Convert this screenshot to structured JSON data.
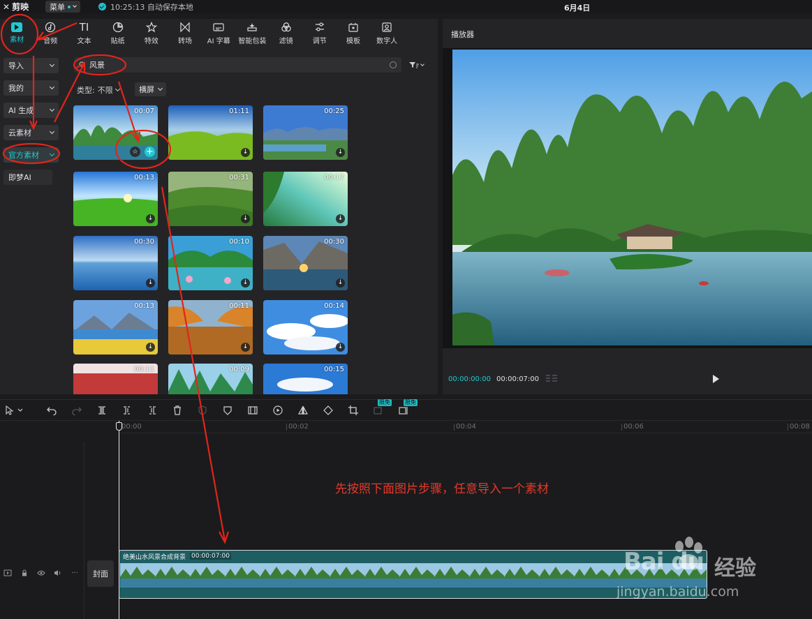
{
  "titlebar": {
    "app_name": "剪映",
    "menu_label": "菜单",
    "save_status": "10:25:13 自动保存本地",
    "date": "6月4日"
  },
  "toolbar": {
    "items": [
      {
        "label": "素材",
        "icon": "media-icon",
        "active": true
      },
      {
        "label": "音频",
        "icon": "audio-icon"
      },
      {
        "label": "文本",
        "icon": "text-icon"
      },
      {
        "label": "贴纸",
        "icon": "sticker-icon"
      },
      {
        "label": "特效",
        "icon": "effects-icon"
      },
      {
        "label": "转场",
        "icon": "transition-icon"
      },
      {
        "label": "AI 字幕",
        "icon": "subtitle-icon"
      },
      {
        "label": "智能包装",
        "icon": "smart-pack-icon"
      },
      {
        "label": "滤镜",
        "icon": "filter-icon"
      },
      {
        "label": "调节",
        "icon": "adjust-icon"
      },
      {
        "label": "模板",
        "icon": "template-icon"
      },
      {
        "label": "数字人",
        "icon": "digital-human-icon"
      }
    ]
  },
  "sidebar": {
    "items": [
      {
        "label": "导入"
      },
      {
        "label": "我的"
      },
      {
        "label": "AI 生成"
      },
      {
        "label": "云素材"
      },
      {
        "label": "官方素材",
        "active": true
      },
      {
        "label": "即梦AI"
      }
    ]
  },
  "search": {
    "value": "风景"
  },
  "filters": {
    "type_label": "类型:",
    "type_value": "不限",
    "orientation": "横屏"
  },
  "thumbnails": [
    {
      "duration": "00:07"
    },
    {
      "duration": "01:11"
    },
    {
      "duration": "00:25"
    },
    {
      "duration": "00:13"
    },
    {
      "duration": "00:31"
    },
    {
      "duration": "00:17"
    },
    {
      "duration": "00:30"
    },
    {
      "duration": "00:10"
    },
    {
      "duration": "00:30"
    },
    {
      "duration": "00:13"
    },
    {
      "duration": "00:11"
    },
    {
      "duration": "00:14"
    },
    {
      "duration": "00:11"
    },
    {
      "duration": "00:09"
    },
    {
      "duration": "00:15"
    }
  ],
  "player": {
    "title": "播放器",
    "current_time": "00:00:00:00",
    "total_time": "00:00:07:00"
  },
  "timeline_toolbar": {
    "badge_1": "限免",
    "badge_2": "限免"
  },
  "ruler": [
    "00:00",
    "00:02",
    "00:04",
    "00:06",
    "00:08"
  ],
  "track": {
    "cover_label": "封面"
  },
  "clip": {
    "title": "绝美山水风景合成背景",
    "duration": "00:00:07:00"
  },
  "annotation": "先按照下面图片步骤，任意导入一个素材",
  "watermark": {
    "brand": "Bai du",
    "cn": "经验",
    "url": "jingyan.baidu.com"
  },
  "colors": {
    "accent": "#23c9d2",
    "annotation": "#e43a2b",
    "panel": "#242427"
  }
}
